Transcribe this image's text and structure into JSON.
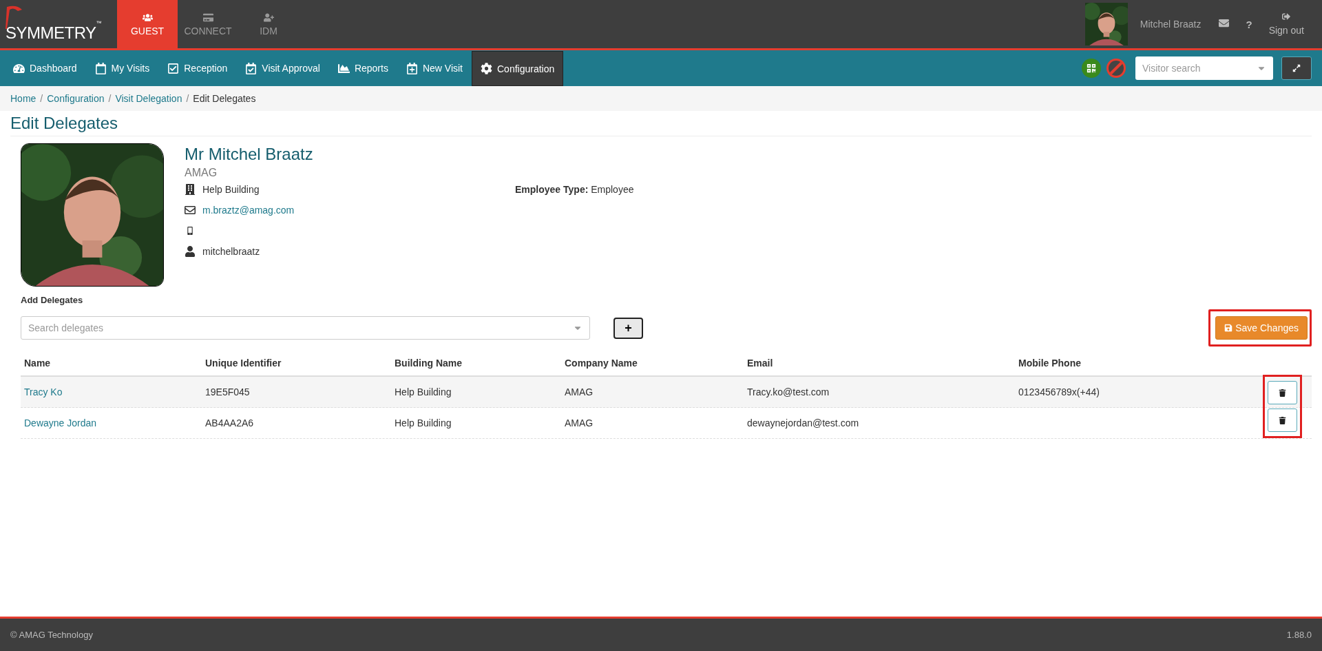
{
  "brand": {
    "logo": "SYMMETRY",
    "trademark": "™"
  },
  "modules": [
    {
      "label": "GUEST",
      "selected": true
    },
    {
      "label": "CONNECT",
      "selected": false
    },
    {
      "label": "IDM",
      "selected": false
    }
  ],
  "user": {
    "name": "Mitchel Braatz",
    "sign_out": "Sign out",
    "help": "?"
  },
  "nav": [
    {
      "label": "Dashboard",
      "selected": false
    },
    {
      "label": "My Visits",
      "selected": false
    },
    {
      "label": "Reception",
      "selected": false
    },
    {
      "label": "Visit Approval",
      "selected": false
    },
    {
      "label": "Reports",
      "selected": false
    },
    {
      "label": "New Visit",
      "selected": false
    },
    {
      "label": "Configuration",
      "selected": true
    }
  ],
  "visitor_search": {
    "placeholder": "Visitor search"
  },
  "breadcrumb_separator": "/",
  "breadcrumb": [
    {
      "label": "Home",
      "current": false
    },
    {
      "label": "Configuration",
      "current": false
    },
    {
      "label": "Visit Delegation",
      "current": false
    },
    {
      "label": "Edit Delegates",
      "current": true
    }
  ],
  "page_title": "Edit Delegates",
  "profile": {
    "name": "Mr Mitchel Braatz",
    "company": "AMAG",
    "building": "Help Building",
    "email": "m.braztz@amag.com",
    "username": "mitchelbraatz",
    "employee_type_label": "Employee Type:",
    "employee_type": "Employee"
  },
  "add_delegates": {
    "label": "Add Delegates",
    "placeholder": "Search delegates",
    "add_button": "+"
  },
  "save_button": "Save Changes",
  "table": {
    "columns": [
      "Name",
      "Unique Identifier",
      "Building Name",
      "Company Name",
      "Email",
      "Mobile Phone"
    ],
    "rows": [
      [
        "Tracy Ko",
        "19E5F045",
        "Help Building",
        "AMAG",
        "Tracy.ko@test.com",
        "0123456789x(+44)"
      ],
      [
        "Dewayne Jordan",
        "AB4AA2A6",
        "Help Building",
        "AMAG",
        "dewaynejordan@test.com",
        ""
      ]
    ]
  },
  "footer": {
    "copyright": "© AMAG Technology",
    "version": "1.88.0"
  }
}
